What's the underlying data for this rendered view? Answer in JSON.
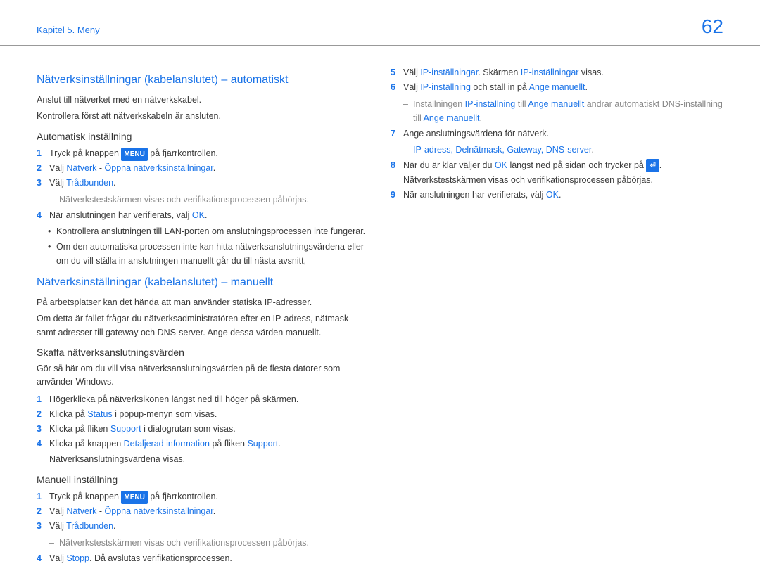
{
  "header": {
    "chapter": "Kapitel 5. Meny",
    "page_number": "62"
  },
  "left": {
    "h2_auto": "Nätverksinställningar (kabelanslutet) – automatiskt",
    "intro1": "Anslut till nätverket med en nätverkskabel.",
    "intro2": "Kontrollera först att nätverkskabeln är ansluten.",
    "h3_auto": "Automatisk inställning",
    "auto1a": "Tryck på knappen ",
    "auto1_badge": "MENU",
    "auto1b": " på fjärrkontrollen.",
    "auto2a": "Välj ",
    "auto2b": "Nätverk",
    "auto2c": " - ",
    "auto2d": "Öppna nätverksinställningar",
    "auto2e": ".",
    "auto3a": "Välj ",
    "auto3b": "Trådbunden",
    "auto3c": ".",
    "auto3_sub": "Nätverkstestskärmen visas och verifikationsprocessen påbörjas.",
    "auto4a": "När anslutningen har verifierats, välj ",
    "auto4b": "OK",
    "auto4c": ".",
    "auto_bul1": "Kontrollera anslutningen till LAN-porten om anslutningsprocessen inte fungerar.",
    "auto_bul2": "Om den automatiska processen inte kan hitta nätverksanslutningsvärdena eller om du vill ställa in anslutningen manuellt går du till nästa avsnitt,",
    "h2_manual": "Nätverksinställningar (kabelanslutet) – manuellt",
    "man_intro1": "På arbetsplatser kan det hända att man använder statiska IP-adresser.",
    "man_intro2": "Om detta är fallet frågar du nätverksadministratören efter en IP-adress, nätmask samt adresser till gateway och DNS-server. Ange dessa värden manuellt.",
    "h3_skaffa": "Skaffa nätverksanslutningsvärden",
    "skaffa_intro": "Gör så här om du vill visa nätverksanslutningsvärden på de flesta datorer som använder Windows.",
    "sk1": "Högerklicka på nätverksikonen längst ned till höger på skärmen.",
    "sk2a": "Klicka på ",
    "sk2b": "Status",
    "sk2c": " i popup-menyn som visas.",
    "sk3a": "Klicka på fliken ",
    "sk3b": "Support",
    "sk3c": " i dialogrutan som visas.",
    "sk4a": "Klicka på knappen ",
    "sk4b": "Detaljerad information",
    "sk4c": " på fliken ",
    "sk4d": "Support",
    "sk4e": ". Nätverksanslutningsvärdena visas.",
    "h3_man": "Manuell inställning",
    "m1a": "Tryck på knappen ",
    "m1_badge": "MENU",
    "m1b": " på fjärrkontrollen.",
    "m2a": "Välj ",
    "m2b": "Nätverk",
    "m2c": " - ",
    "m2d": "Öppna nätverksinställningar",
    "m2e": ".",
    "m3a": "Välj ",
    "m3b": "Trådbunden",
    "m3c": ".",
    "m3_sub": "Nätverkstestskärmen visas och verifikationsprocessen påbörjas.",
    "m4a": "Välj ",
    "m4b": "Stopp",
    "m4c": ". Då avslutas verifikationsprocessen."
  },
  "right": {
    "r5a": "Välj ",
    "r5b": "IP-inställningar",
    "r5c": ". Skärmen ",
    "r5d": "IP-inställningar",
    "r5e": " visas.",
    "r6a": "Välj ",
    "r6b": "IP-inställning",
    "r6c": " och ställ in på ",
    "r6d": "Ange manuellt",
    "r6e": ".",
    "r6_sub_a": "Inställningen ",
    "r6_sub_b": "IP-inställning",
    "r6_sub_c": " till ",
    "r6_sub_d": "Ange manuellt",
    "r6_sub_e": " ändrar automatiskt DNS-inställning till ",
    "r6_sub_f": "Ange manuellt",
    "r6_sub_g": ".",
    "r7": "Ange anslutningsvärdena för nätverk.",
    "r7_sub": "IP-adress, Delnätmask, Gateway, DNS-server",
    "r7_sub_dot": ".",
    "r8a": "När du är klar väljer du ",
    "r8b": "OK",
    "r8c": " längst ned på sidan och trycker på ",
    "r8_badge": "⏎",
    "r8d": ". Nätverkstestskärmen visas och verifikationsprocessen påbörjas.",
    "r9a": "När anslutningen har verifierats, välj ",
    "r9b": "OK",
    "r9c": "."
  }
}
